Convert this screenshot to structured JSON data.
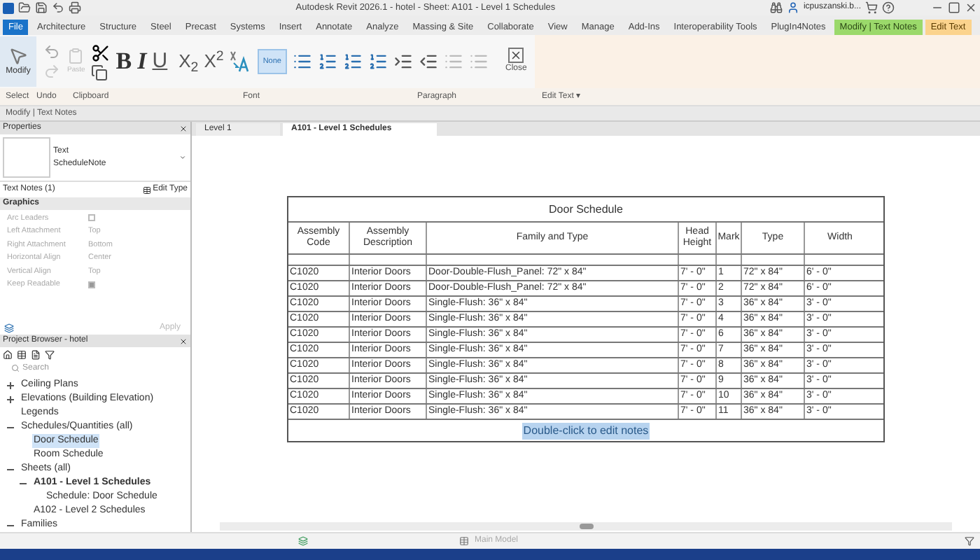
{
  "window": {
    "title": "Autodesk Revit 2026.1 - hotel - Sheet: A101 - Level 1 Schedules",
    "user": "icpuszanski.b..."
  },
  "ribbon_tabs": [
    {
      "label": "File",
      "kind": "file",
      "selected": false
    },
    {
      "label": "Architecture",
      "kind": "tab",
      "selected": false
    },
    {
      "label": "Structure",
      "kind": "tab",
      "selected": false
    },
    {
      "label": "Steel",
      "kind": "tab",
      "selected": false
    },
    {
      "label": "Precast",
      "kind": "tab",
      "selected": false
    },
    {
      "label": "Systems",
      "kind": "tab",
      "selected": false
    },
    {
      "label": "Insert",
      "kind": "tab",
      "selected": false
    },
    {
      "label": "Annotate",
      "kind": "tab",
      "selected": false
    },
    {
      "label": "Analyze",
      "kind": "tab",
      "selected": false
    },
    {
      "label": "Massing & Site",
      "kind": "tab",
      "selected": false
    },
    {
      "label": "Collaborate",
      "kind": "tab",
      "selected": false
    },
    {
      "label": "View",
      "kind": "tab",
      "selected": false
    },
    {
      "label": "Manage",
      "kind": "tab",
      "selected": false
    },
    {
      "label": "Add-Ins",
      "kind": "tab",
      "selected": false
    },
    {
      "label": "Interoperability Tools",
      "kind": "tab",
      "selected": false
    },
    {
      "label": "PlugIn4Notes",
      "kind": "tab",
      "selected": false
    },
    {
      "label": "Modify | Text Notes",
      "kind": "context",
      "selected": false
    },
    {
      "label": "Edit Text",
      "kind": "edit",
      "selected": true
    }
  ],
  "ribbon": {
    "modify": "Modify",
    "paste": "Paste",
    "bold": "B",
    "italic": "I",
    "underline": "U",
    "subscript": "X$_{2}$",
    "superscript": "X$^{2}$",
    "none_button": {
      "label": "None",
      "selected": true
    },
    "close": "Close",
    "panels": [
      "Select",
      "Undo",
      "Clipboard",
      "Font",
      "Paragraph",
      "Edit Text ▾"
    ]
  },
  "context_bar": "Modify | Text Notes",
  "properties": {
    "title": "Properties",
    "type_line1": "Text",
    "type_line2": "ScheduleNote",
    "instance": "Text Notes (1)",
    "edit_type": "Edit Type",
    "section": "Graphics",
    "apply": "Apply",
    "rows": [
      {
        "label": "Arc Leaders",
        "kind": "checkbox",
        "checked": false,
        "disabled": true
      },
      {
        "label": "Left Attachment",
        "kind": "text",
        "value": "Top",
        "disabled": true
      },
      {
        "label": "Right Attachment",
        "kind": "text",
        "value": "Bottom",
        "disabled": true
      },
      {
        "label": "Horizontal Align",
        "kind": "text",
        "value": "Center",
        "disabled": true
      },
      {
        "label": "Vertical Align",
        "kind": "text",
        "value": "Top",
        "disabled": true
      },
      {
        "label": "Keep Readable",
        "kind": "checkbox",
        "checked": true,
        "disabled": true
      }
    ]
  },
  "project_browser": {
    "title": "Project Browser - hotel",
    "search_placeholder": "Search",
    "tree": [
      {
        "label": "Ceiling Plans",
        "expanded": false,
        "selected": false
      },
      {
        "label": "Elevations (Building Elevation)",
        "expanded": false,
        "selected": false
      },
      {
        "label": "Legends",
        "selected": false
      },
      {
        "label": "Schedules/Quantities (all)",
        "expanded": true,
        "selected": false,
        "children": [
          {
            "label": "Door Schedule",
            "selected": true
          },
          {
            "label": "Room Schedule",
            "selected": false
          }
        ]
      },
      {
        "label": "Sheets (all)",
        "expanded": true,
        "selected": false,
        "children": [
          {
            "label": "A101 - Level 1 Schedules",
            "bold": true,
            "expanded": true,
            "selected": false,
            "children": [
              {
                "label": "Schedule: Door Schedule",
                "selected": false
              }
            ]
          },
          {
            "label": "A102 - Level 2 Schedules",
            "selected": false
          }
        ]
      },
      {
        "label": "Families",
        "expanded": true,
        "selected": false
      }
    ]
  },
  "view_tabs": [
    {
      "label": "Level 1",
      "selected": false
    },
    {
      "label": "A101 - Level 1 Schedules",
      "selected": true
    }
  ],
  "schedule": {
    "title": "Door Schedule",
    "columns": [
      "Assembly Code",
      "Assembly Description",
      "Family and Type",
      "Head Height",
      "Mark",
      "Type",
      "Width"
    ],
    "rows": [
      [
        "C1020",
        "Interior Doors",
        "Door-Double-Flush_Panel: 72\" x 84\"",
        "7' - 0\"",
        "1",
        "72\" x 84\"",
        "6' - 0\""
      ],
      [
        "C1020",
        "Interior Doors",
        "Door-Double-Flush_Panel: 72\" x 84\"",
        "7' - 0\"",
        "2",
        "72\" x 84\"",
        "6' - 0\""
      ],
      [
        "C1020",
        "Interior Doors",
        "Single-Flush: 36\" x 84\"",
        "7' - 0\"",
        "3",
        "36\" x 84\"",
        "3' - 0\""
      ],
      [
        "C1020",
        "Interior Doors",
        "Single-Flush: 36\" x 84\"",
        "7' - 0\"",
        "4",
        "36\" x 84\"",
        "3' - 0\""
      ],
      [
        "C1020",
        "Interior Doors",
        "Single-Flush: 36\" x 84\"",
        "7' - 0\"",
        "6",
        "36\" x 84\"",
        "3' - 0\""
      ],
      [
        "C1020",
        "Interior Doors",
        "Single-Flush: 36\" x 84\"",
        "7' - 0\"",
        "7",
        "36\" x 84\"",
        "3' - 0\""
      ],
      [
        "C1020",
        "Interior Doors",
        "Single-Flush: 36\" x 84\"",
        "7' - 0\"",
        "8",
        "36\" x 84\"",
        "3' - 0\""
      ],
      [
        "C1020",
        "Interior Doors",
        "Single-Flush: 36\" x 84\"",
        "7' - 0\"",
        "9",
        "36\" x 84\"",
        "3' - 0\""
      ],
      [
        "C1020",
        "Interior Doors",
        "Single-Flush: 36\" x 84\"",
        "7' - 0\"",
        "10",
        "36\" x 84\"",
        "3' - 0\""
      ],
      [
        "C1020",
        "Interior Doors",
        "Single-Flush: 36\" x 84\"",
        "7' - 0\"",
        "11",
        "36\" x 84\"",
        "3' - 0\""
      ]
    ],
    "note": {
      "text": "Double-click to edit notes",
      "selected": true
    }
  },
  "status_bar": {
    "model": "Main Model"
  }
}
